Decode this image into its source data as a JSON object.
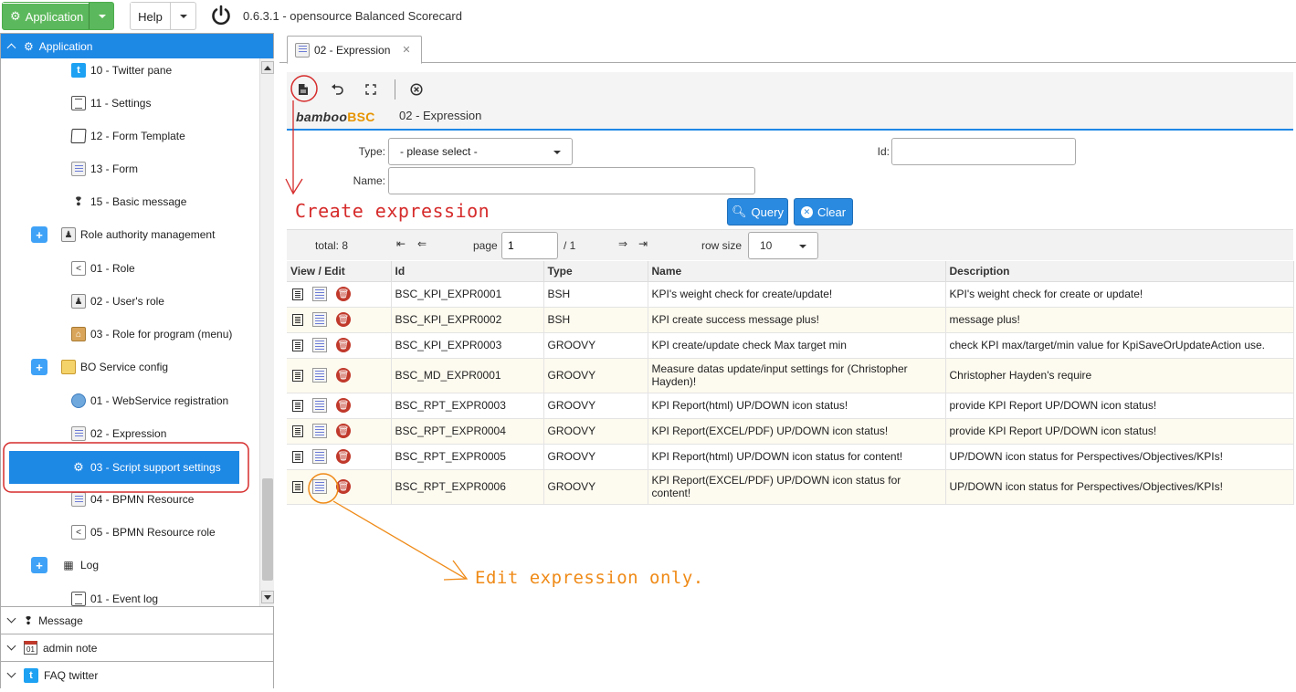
{
  "topbar": {
    "app_button_label": "Application",
    "help_button_label": "Help",
    "version_text": "0.6.3.1 - opensource Balanced Scorecard"
  },
  "sidebar": {
    "active_section": "Application",
    "tree_items": [
      {
        "label": "10 - Twitter pane",
        "icon": "twitter-icon"
      },
      {
        "label": "11 - Settings",
        "icon": "document-icon"
      },
      {
        "label": "12 - Form Template",
        "icon": "template-icon"
      },
      {
        "label": "13 - Form",
        "icon": "form-icon"
      },
      {
        "label": "15 - Basic message",
        "icon": "message-icon"
      },
      {
        "label": "Role authority management",
        "icon": "user-icon"
      },
      {
        "label": "01 - Role",
        "icon": "share-icon"
      },
      {
        "label": "02 - User's role",
        "icon": "user-icon"
      },
      {
        "label": "03 - Role for program (menu)",
        "icon": "home-icon"
      },
      {
        "label": "BO Service config",
        "icon": "service-icon"
      },
      {
        "label": "01 - WebService registration",
        "icon": "globe-icon"
      },
      {
        "label": "02 - Expression",
        "icon": "form-icon"
      },
      {
        "label": "03 - Script support settings",
        "icon": "gear-icon"
      },
      {
        "label": "04 - BPMN Resource",
        "icon": "form-icon"
      },
      {
        "label": "05 - BPMN Resource role",
        "icon": "share-icon"
      },
      {
        "label": "Log",
        "icon": "grid-icon"
      },
      {
        "label": "01 - Event log",
        "icon": "document-icon"
      }
    ],
    "sections": [
      {
        "label": "Message"
      },
      {
        "label": "admin note"
      },
      {
        "label": "FAQ twitter"
      }
    ]
  },
  "main": {
    "tab_label": "02 - Expression",
    "brand_main": "bamboo",
    "brand_accent": "BSC",
    "page_title": "02 - Expression",
    "form": {
      "type_label": "Type:",
      "type_value": "- please select -",
      "id_label": "Id:",
      "id_value": "",
      "name_label": "Name:",
      "name_value": ""
    },
    "query_label": "Query",
    "clear_label": "Clear",
    "pager": {
      "total_text": "total: 8",
      "page_label": "page",
      "page_value": "1",
      "page_total": "/ 1",
      "rowsize_label": "row size",
      "rowsize_value": "10"
    },
    "table": {
      "columns": [
        "View / Edit",
        "Id",
        "Type",
        "Name",
        "Description"
      ],
      "rows": [
        {
          "id": "BSC_KPI_EXPR0001",
          "type": "BSH",
          "name": "KPI's weight check for create/update!",
          "description": "KPI's weight check for create or update!"
        },
        {
          "id": "BSC_KPI_EXPR0002",
          "type": "BSH",
          "name": "KPI create success message plus!",
          "description": "message plus!"
        },
        {
          "id": "BSC_KPI_EXPR0003",
          "type": "GROOVY",
          "name": "KPI create/update check Max target min",
          "description": "check KPI max/target/min value for KpiSaveOrUpdateAction use."
        },
        {
          "id": "BSC_MD_EXPR0001",
          "type": "GROOVY",
          "name": "Measure datas update/input settings for (Christopher Hayden)!",
          "description": "Christopher Hayden's require"
        },
        {
          "id": "BSC_RPT_EXPR0003",
          "type": "GROOVY",
          "name": "KPI Report(html) UP/DOWN icon status!",
          "description": "provide KPI Report UP/DOWN icon status!"
        },
        {
          "id": "BSC_RPT_EXPR0004",
          "type": "GROOVY",
          "name": "KPI Report(EXCEL/PDF) UP/DOWN icon status!",
          "description": "provide KPI Report UP/DOWN icon status!"
        },
        {
          "id": "BSC_RPT_EXPR0005",
          "type": "GROOVY",
          "name": "KPI Report(html) UP/DOWN icon status for content!",
          "description": "UP/DOWN icon status for Perspectives/Objectives/KPIs!"
        },
        {
          "id": "BSC_RPT_EXPR0006",
          "type": "GROOVY",
          "name": "KPI Report(EXCEL/PDF) UP/DOWN icon status for content!",
          "description": "UP/DOWN icon status for Perspectives/Objectives/KPIs!"
        }
      ]
    }
  },
  "annotations": {
    "create_text": "Create expression",
    "edit_text": "Edit expression only.",
    "red_color": "#d62b2b",
    "orange_color": "#ef8a17"
  },
  "colors": {
    "accent_blue": "#1e88e5",
    "app_green": "#5cb85c"
  }
}
